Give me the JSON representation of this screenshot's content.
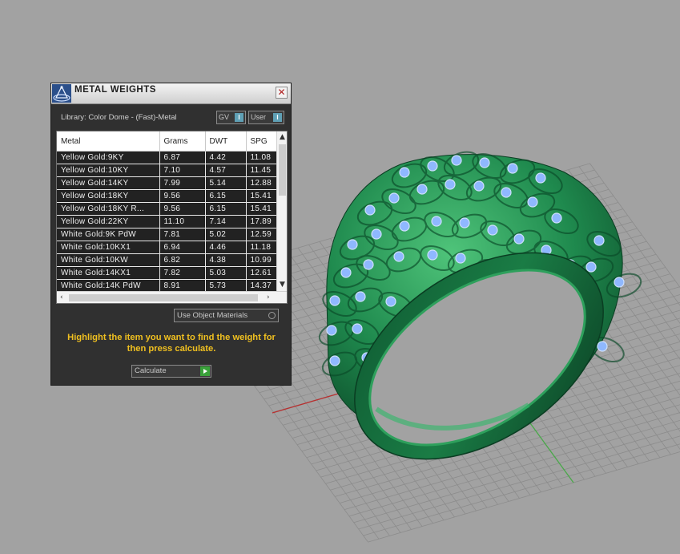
{
  "panel": {
    "title": "METAL WEIGHTS",
    "close_glyph": "✕",
    "library_label": "Library: Color Dome - (Fast)-Metal",
    "gv_label": "GV",
    "gv_state": "I",
    "user_label": "User",
    "user_state": "I",
    "columns": [
      "Metal",
      "Grams",
      "DWT",
      "SPG"
    ],
    "rows": [
      [
        "Yellow Gold:9KY",
        "6.87",
        "4.42",
        "11.08"
      ],
      [
        "Yellow Gold:10KY",
        "7.10",
        "4.57",
        "11.45"
      ],
      [
        "Yellow Gold:14KY",
        "7.99",
        "5.14",
        "12.88"
      ],
      [
        "Yellow Gold:18KY",
        "9.56",
        "6.15",
        "15.41"
      ],
      [
        "Yellow Gold:18KY R...",
        "9.56",
        "6.15",
        "15.41"
      ],
      [
        "Yellow Gold:22KY",
        "11.10",
        "7.14",
        "17.89"
      ],
      [
        "White Gold:9K PdW",
        "7.81",
        "5.02",
        "12.59"
      ],
      [
        "White Gold:10KX1",
        "6.94",
        "4.46",
        "11.18"
      ],
      [
        "White Gold:10KW",
        "6.82",
        "4.38",
        "10.99"
      ],
      [
        "White Gold:14KX1",
        "7.82",
        "5.03",
        "12.61"
      ],
      [
        "White Gold:14K PdW",
        "8.91",
        "5.73",
        "14.37"
      ]
    ],
    "use_object_materials_label": "Use Object Materials",
    "instruction": "Highlight the item you want to find the weight for then press calculate.",
    "calculate_label": "Calculate"
  },
  "colors": {
    "viewport_bg": "#a2a2a2",
    "grid": "#8c8c8c",
    "x_axis": "#b83030",
    "y_axis": "#4aa84a",
    "ring": "#1f8a4e",
    "ring_dark": "#0d4d2a",
    "gem": "#8fb8ff",
    "instruction_text": "#f0c020"
  },
  "icons": [
    "app-logo-icon",
    "close-icon",
    "scroll-up-icon",
    "scroll-down-icon",
    "scroll-left-icon",
    "scroll-right-icon",
    "play-icon"
  ]
}
